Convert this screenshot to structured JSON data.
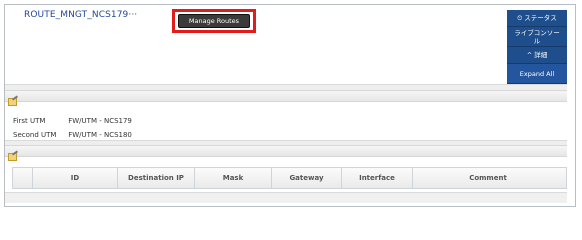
{
  "header": {
    "device_name": "ROUTE_MNGT_NCS179···",
    "manage_routes_label": "Manage Routes"
  },
  "side_panel": {
    "status_label": "⏲ ステータス",
    "live_console_label": "ライブコンソー\nル",
    "details_label": "^ 詳細",
    "expand_all_label": "Expand All"
  },
  "info": {
    "rows": [
      {
        "label": "First UTM",
        "value": "FW/UTM - NCS179"
      },
      {
        "label": "Second UTM",
        "value": "FW/UTM - NCS180"
      }
    ]
  },
  "table": {
    "columns": [
      "",
      "ID",
      "Destination IP",
      "Mask",
      "Gateway",
      "Interface",
      "Comment"
    ]
  },
  "colors": {
    "highlight": "#e21b1b",
    "title": "#24479a",
    "side_button": "#1f4e8c"
  }
}
